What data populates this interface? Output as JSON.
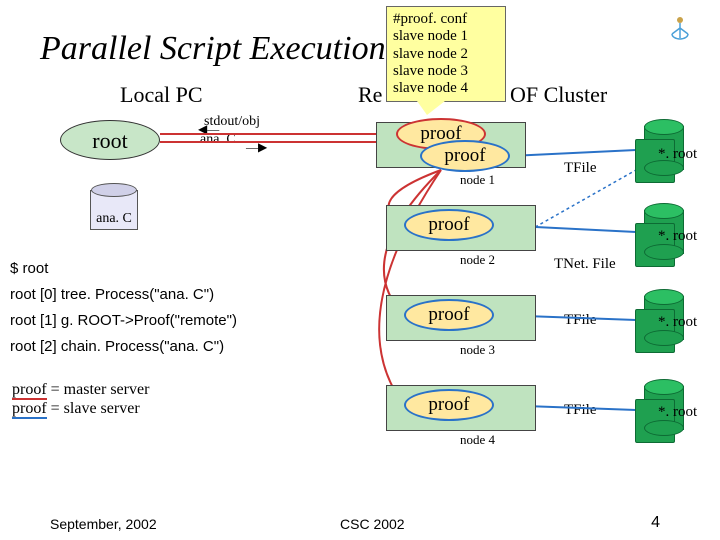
{
  "title": "Parallel Script Execution",
  "local_pc_label": "Local PC",
  "cluster_label_prefix": "Re",
  "cluster_label_suffix": "OF Cluster",
  "conf": {
    "header": "#proof. conf",
    "lines": [
      "slave node 1",
      "slave node 2",
      "slave node 3",
      "slave node 4"
    ]
  },
  "root_label": "root",
  "stdout_label": "stdout/obj",
  "anac_arrow_label": "ana. C",
  "anac_file_label": "ana. C",
  "commands": {
    "prompt": "$ root",
    "c1": "root [0] tree. Process(\"ana. C\")",
    "c2": "root [1] g. ROOT->Proof(\"remote\")",
    "c3": "root [2] chain. Process(\"ana. C\")"
  },
  "legend": {
    "master": "proof",
    "master_tail": " = master server",
    "slave": "proof",
    "slave_tail": " = slave server"
  },
  "proof_label": "proof",
  "nodes": [
    "node 1",
    "node 2",
    "node 3",
    "node 4"
  ],
  "file_conn": [
    "TFile",
    "TNet. File",
    "TFile",
    "TFile"
  ],
  "rootfile_label": "*. root",
  "footer": {
    "left": "September, 2002",
    "center": "CSC 2002",
    "right": "4"
  }
}
